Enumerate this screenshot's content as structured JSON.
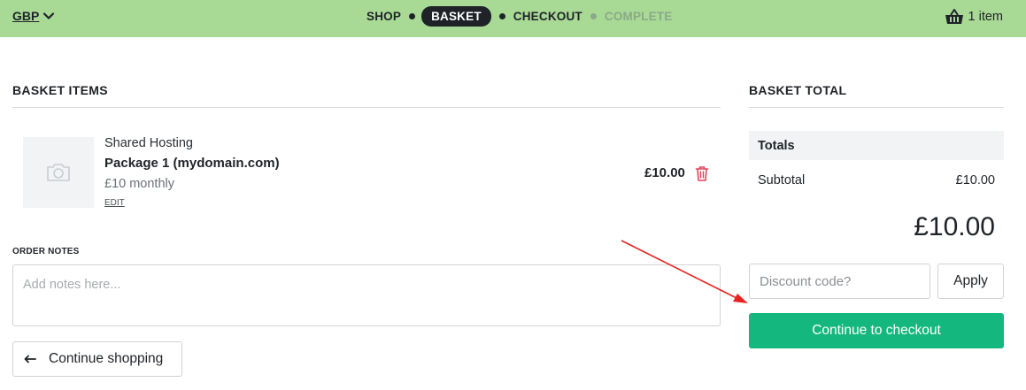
{
  "header": {
    "currency": "GBP",
    "steps": [
      {
        "label": "SHOP",
        "state": "done"
      },
      {
        "label": "BASKET",
        "state": "active"
      },
      {
        "label": "CHECKOUT",
        "state": "upcoming"
      },
      {
        "label": "COMPLETE",
        "state": "disabled"
      }
    ],
    "cart_count": "1 item"
  },
  "basket": {
    "heading": "BASKET ITEMS",
    "items": [
      {
        "category": "Shared Hosting",
        "name": "Package 1 (mydomain.com)",
        "price_line": "£10 monthly",
        "edit_label": "EDIT",
        "total": "£10.00"
      }
    ],
    "notes_label": "ORDER NOTES",
    "notes_placeholder": "Add notes here...",
    "continue_shopping_label": "Continue shopping"
  },
  "totals": {
    "heading": "BASKET TOTAL",
    "subheading": "Totals",
    "subtotal_label": "Subtotal",
    "subtotal_value": "£10.00",
    "grand_total": "£10.00",
    "discount_placeholder": "Discount code?",
    "apply_label": "Apply",
    "checkout_label": "Continue to checkout"
  },
  "colors": {
    "topbar": "#a8d995",
    "checkout_button": "#14b87e",
    "delete_icon": "#e0455a",
    "annotation_arrow": "#e8231f"
  },
  "icons": [
    "chevron-down-icon",
    "basket-icon",
    "camera-icon",
    "trash-icon",
    "arrow-left-icon"
  ]
}
